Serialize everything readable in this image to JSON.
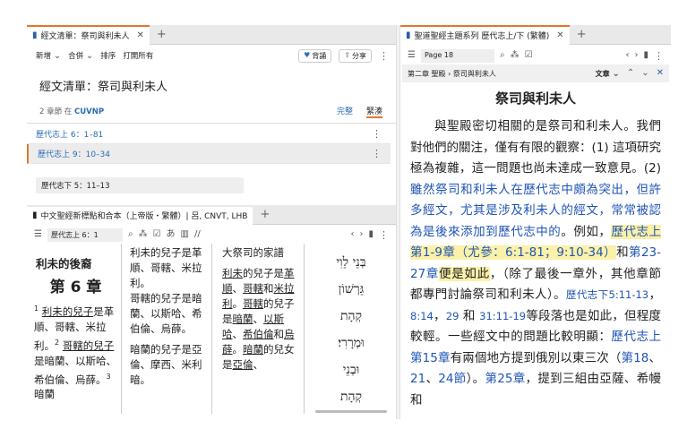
{
  "left_pane": {
    "tab_title": "經文清單：祭司與利未人",
    "toolbar": {
      "new": "新增",
      "merge": "合併",
      "sort": "排序",
      "open_all": "打開所有",
      "back_btn": "背誦",
      "share_btn": "分享"
    },
    "heading": "經文清單：祭司與利未人",
    "subtitle": "2 章節 在",
    "version": "CUVNP",
    "mode_complete": "完整",
    "mode_compact": "緊湊",
    "items": [
      {
        "ref": "歷代志上 6：1–81"
      },
      {
        "ref": "歷代志上 9：10–34"
      }
    ],
    "input_value": "歷代志下 5：11–13"
  },
  "bible_pane": {
    "tab_title": "中文聖經新標點和合本（上帝版・繁體）| 呂, CNVT, LHB",
    "ref_box": "歷代志上 6：1",
    "col1": {
      "heading": "利未的後裔",
      "chapter": "第 6 章",
      "v1": "1",
      "t1a": "利未的兒子",
      "t1b": "是革順、哥轄、米拉利。",
      "v2": "2",
      "t2a": "哥轄的兒子",
      "t2b": "是暗蘭、以斯哈、希伯倫、烏薛。",
      "v3": "3",
      "t3": "暗蘭"
    },
    "col2": {
      "p1": "利未的兒子是革順、哥轄、米拉利。",
      "p2": "哥轄的兒子是暗蘭、以斯哈、希伯倫、烏薛。",
      "p3": "暗蘭的兒子是亞倫、摩西、米利暗。"
    },
    "col3": {
      "p0": "大祭司的家譜",
      "p1a": "利未",
      "p1b": "的兒子是",
      "p1c": "革順",
      "p1d": "、",
      "p1e": "哥轄",
      "p1f": "和",
      "p1g": "米拉利",
      "p1h": "。",
      "p2a": "哥轄",
      "p2b": "的兒子是",
      "p2c": "暗蘭",
      "p2d": "、",
      "p2e": "以斯哈",
      "p2f": "、",
      "p2g": "希伯倫",
      "p2h": "和",
      "p2i": "烏薛",
      "p2j": "。",
      "p2k": "暗蘭",
      "p2l": "的兒女是",
      "p2m": "亞倫",
      "p2n": "、"
    },
    "col4": [
      "בְּנֵי לֵוִי",
      "גֵּרְשׁוֹן",
      "קְהָת",
      "וּמְרָרִי׃",
      "וּבְנֵי",
      "קְהָת"
    ]
  },
  "right_pane": {
    "tab_title": "聖道聖經主題系列 歷代志上/下 (繁體)",
    "page_input": "Page 18",
    "breadcrumb": "第二章 聖殿 › 祭司與利未人",
    "text_btn": "文章",
    "article_title": "祭司與利未人",
    "s1": "與聖殿密切相關的是祭司和利未人。我們對他們的關注，僅有有限的觀察：(1) 這項研究極為複雜，這一問題也尚未達成一致意見。(2) ",
    "s2": "雖然祭司和利未人在歷代志中頗為突出，但許多經文，尤其是涉及利未人的經文，常常被認為是後來添加到歷代志中的",
    "s3": "。例如，",
    "s4": "歷代志上第1-9章（尤參：6:1-81；9:10-34）",
    "s5": "和",
    "s6": "第23-27章",
    "s7": "便是如此",
    "s8": "，（除了最後一章外，其他章節都專門討論祭司和利未人）。",
    "s9": "歷代志下5:11-13",
    "s10": "，",
    "s11": "8:14",
    "s12": "，",
    "s13": "29",
    "s14": " 和 ",
    "s15": "31:11-19",
    "s16": "等段落也是如此，但程度較輕。一些經文中的問題比較明顯：",
    "s17": "歷代志上第15章",
    "s18": "有兩個地方提到俄別以東三次（",
    "s19": "第18",
    "s20": "、",
    "s21": "21",
    "s22": "、",
    "s23": "24節",
    "s24": "）。",
    "s25": "第25章",
    "s26": "，提到三組由亞薩、希幔和"
  }
}
